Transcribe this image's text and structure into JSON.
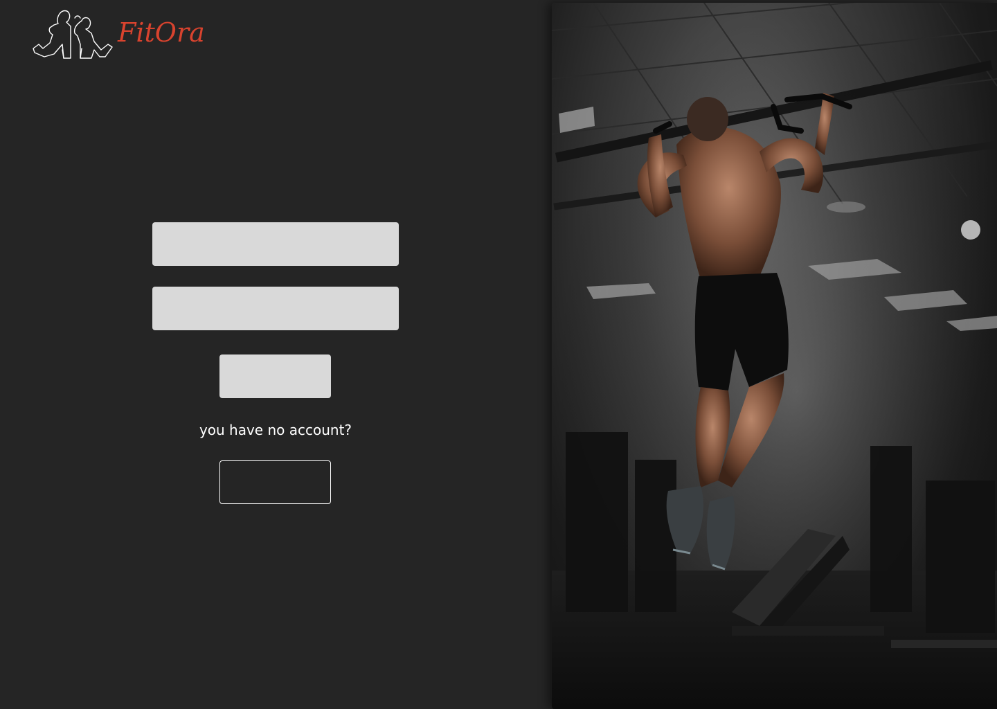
{
  "brand": {
    "name": "FitOra",
    "logo_icon": "fitness-couple-logo-icon",
    "color": "#d8432e"
  },
  "login_form": {
    "email_value": "",
    "email_placeholder": "",
    "password_value": "",
    "password_placeholder": "",
    "login_label": "",
    "no_account_text": "you have no account?",
    "signup_label": ""
  },
  "hero": {
    "image": "man-doing-pull-ups-in-dark-gym"
  },
  "colors": {
    "background": "#252525",
    "field": "#d9d9d9",
    "text": "#ffffff"
  }
}
